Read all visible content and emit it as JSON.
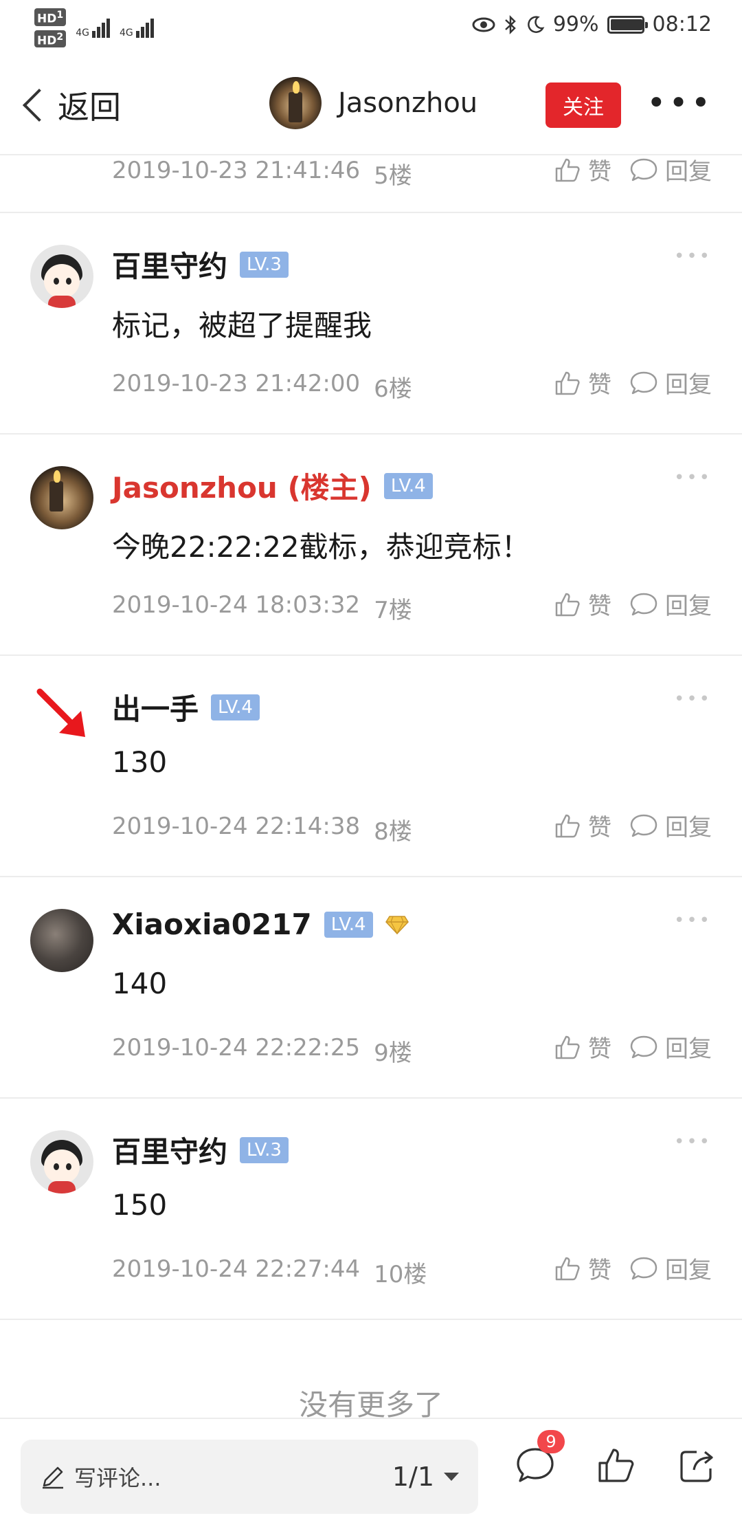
{
  "status_bar": {
    "hd1": "HD",
    "hd1_sub": "1",
    "hd2": "HD",
    "hd2_sub": "2",
    "net1": "4G",
    "net2": "4G",
    "battery": "99%",
    "time": "08:12"
  },
  "nav": {
    "back_label": "返回",
    "username": "Jasonzhou",
    "follow_label": "关注",
    "more_label": "•••"
  },
  "partial_comment": {
    "timestamp": "2019-10-23 21:41:46",
    "floor": "5楼",
    "like_label": "赞",
    "reply_label": "回复"
  },
  "comments": [
    {
      "name": "百里守约",
      "level": "LV.3",
      "text": "标记，被超了提醒我",
      "timestamp": "2019-10-23 21:42:00",
      "floor": "6楼",
      "like_label": "赞",
      "reply_label": "回复",
      "more": "•••"
    },
    {
      "name": "Jasonzhou (楼主)",
      "level": "LV.4",
      "text": "今晚22:22:22截标，恭迎竞标！",
      "timestamp": "2019-10-24 18:03:32",
      "floor": "7楼",
      "like_label": "赞",
      "reply_label": "回复",
      "more": "•••"
    },
    {
      "name": "出一手",
      "level": "LV.4",
      "text": "130",
      "timestamp": "2019-10-24 22:14:38",
      "floor": "8楼",
      "like_label": "赞",
      "reply_label": "回复",
      "more": "•••"
    },
    {
      "name": "Xiaoxia0217",
      "level": "LV.4",
      "text": "140",
      "timestamp": "2019-10-24 22:22:25",
      "floor": "9楼",
      "like_label": "赞",
      "reply_label": "回复",
      "more": "•••"
    },
    {
      "name": "百里守约",
      "level": "LV.3",
      "text": "150",
      "timestamp": "2019-10-24 22:27:44",
      "floor": "10楼",
      "like_label": "赞",
      "reply_label": "回复",
      "more": "•••"
    }
  ],
  "end_text": "没有更多了",
  "bottom_bar": {
    "comment_placeholder": "写评论...",
    "page_indicator": "1/1",
    "comment_badge": "9"
  },
  "colors": {
    "accent_red": "#e3262b",
    "owner_name": "#d9362f",
    "level_badge": "#8fb3e6",
    "meta_gray": "#9a9a9a",
    "badge_red": "#f2474b"
  },
  "icons": [
    "back-chevron-icon",
    "thumb-up-icon",
    "reply-bubble-icon",
    "more-dots-icon",
    "diamond-icon",
    "red-arrow-icon",
    "pen-icon",
    "dropdown-caret-icon",
    "comment-icon",
    "like-icon",
    "share-icon"
  ]
}
